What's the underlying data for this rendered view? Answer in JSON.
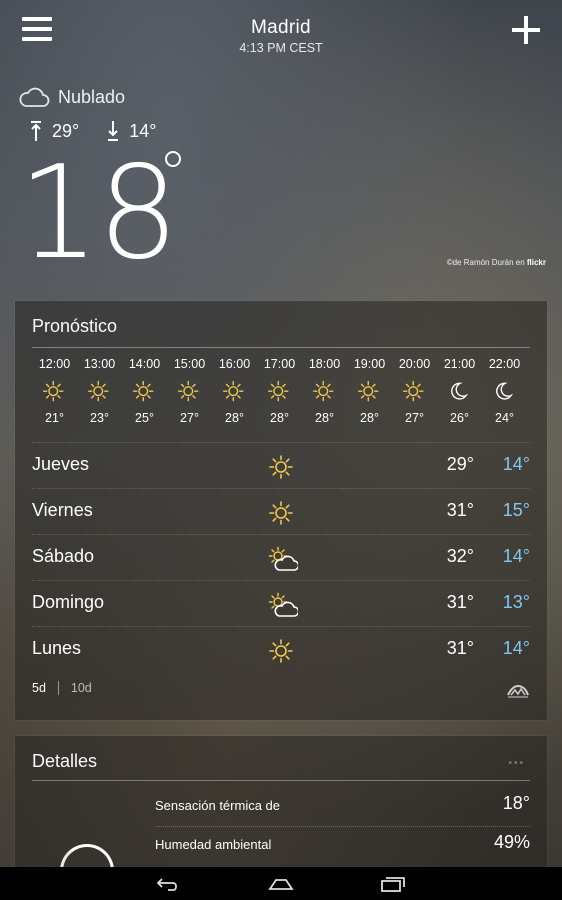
{
  "header": {
    "city": "Madrid",
    "time": "4:13 PM CEST"
  },
  "current": {
    "condition": "Nublado",
    "high": "29°",
    "low": "14°",
    "temp": "18",
    "icon": "cloud-icon"
  },
  "photo_credit": {
    "prefix": "©de Ramón Durán en ",
    "source": "flickr"
  },
  "forecast": {
    "title": "Pronóstico",
    "hourly": [
      {
        "time": "12:00",
        "icon": "sun-icon",
        "temp": "21°"
      },
      {
        "time": "13:00",
        "icon": "sun-icon",
        "temp": "23°"
      },
      {
        "time": "14:00",
        "icon": "sun-icon",
        "temp": "25°"
      },
      {
        "time": "15:00",
        "icon": "sun-icon",
        "temp": "27°"
      },
      {
        "time": "16:00",
        "icon": "sun-icon",
        "temp": "28°"
      },
      {
        "time": "17:00",
        "icon": "sun-icon",
        "temp": "28°"
      },
      {
        "time": "18:00",
        "icon": "sun-icon",
        "temp": "28°"
      },
      {
        "time": "19:00",
        "icon": "sun-icon",
        "temp": "28°"
      },
      {
        "time": "20:00",
        "icon": "sun-icon",
        "temp": "27°"
      },
      {
        "time": "21:00",
        "icon": "moon-icon",
        "temp": "26°"
      },
      {
        "time": "22:00",
        "icon": "moon-icon",
        "temp": "24°"
      }
    ],
    "daily": [
      {
        "day": "Jueves",
        "icon": "sun-icon",
        "high": "29°",
        "low": "14°"
      },
      {
        "day": "Viernes",
        "icon": "sun-icon",
        "high": "31°",
        "low": "15°"
      },
      {
        "day": "Sábado",
        "icon": "partly-cloudy-icon",
        "high": "32°",
        "low": "14°"
      },
      {
        "day": "Domingo",
        "icon": "partly-cloudy-icon",
        "high": "31°",
        "low": "13°"
      },
      {
        "day": "Lunes",
        "icon": "sun-icon",
        "high": "31°",
        "low": "14°"
      }
    ],
    "range_5d": "5d",
    "range_10d": "10d"
  },
  "details": {
    "title": "Detalles",
    "rows": [
      {
        "label": "Sensación térmica de",
        "value": "18°"
      },
      {
        "label": "Humedad ambiental",
        "value": "49%"
      }
    ]
  },
  "colors": {
    "sun": "#f2c94c",
    "low_temp": "#7fc8f0"
  }
}
